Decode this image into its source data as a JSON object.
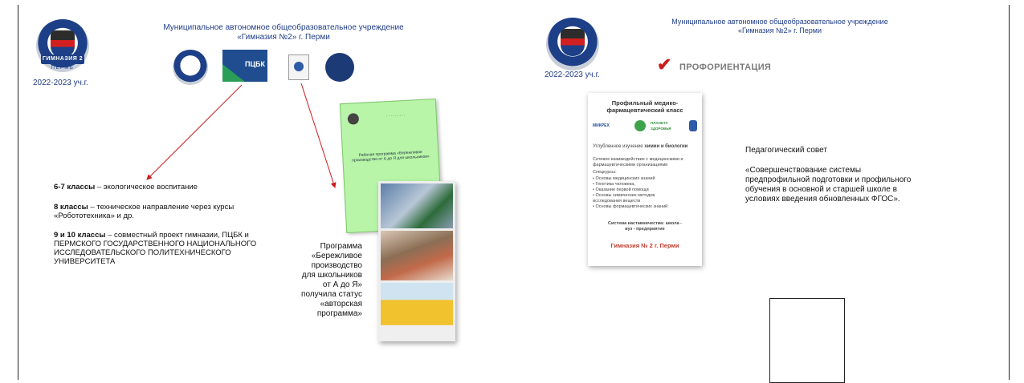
{
  "left_slide": {
    "header_line1": "Муниципальное автономное общеобразовательное учреждение",
    "header_line2": "«Гимназия №2» г. Перми",
    "year": "2022-2023 уч.г.",
    "logo_ribbon": "ГИМНАЗИЯ 2",
    "logo_perm": "ПЕРМЬ",
    "pcbk_label": "ПЦБК",
    "booklet_title": "Рабочая программа «Бережливое производство от А до Я для школьников»",
    "items": [
      {
        "bold": "6-7 классы",
        "text": " – экологическое воспитание"
      },
      {
        "bold": "8 классы",
        "text": " – техническое направление через курсы «Робототехника» и др."
      },
      {
        "bold": "9 и 10 классы",
        "text": " – совместный проект гимназии,  ПЦБК и ПЕРМСКОГО ГОСУДАРСТВЕННОГО НАЦИОНАЛЬНОГО ИССЛЕДОВАТЕЛЬСКОГО ПОЛИТЕХНИЧЕСКОГО  УНИВЕРСИТЕТА"
      }
    ],
    "program_text": "Программа «Бережливое производство для школьников от А до Я» получила статус «авторская программа»"
  },
  "right_slide": {
    "header_line1": "Муниципальное автономное общеобразовательное учреждение",
    "header_line2": "«Гимназия №2» г. Перми",
    "year": "2022-2023 уч.г.",
    "section_title": "ПРОФОРИЕНТАЦИЯ",
    "poster": {
      "title": "Профильный медико-фармацевтический класс",
      "logo1": "МИКРЕХ",
      "logo2": "ПЛАНЕТА ЗДОРОВЬЯ",
      "subtitle_pre": "Углубленное изучение ",
      "subtitle_bold": "химии и биологии",
      "network": "Сетевое взаимодействие с медицинскими и фармацевтическими организациями",
      "courses_label": "Спецкурсы:",
      "courses": [
        "Основы медицинских знаний",
        "Генетика человека,",
        "Оказание первой помощи",
        "Основы химических методов исследования веществ",
        "Основы формацевтических знаний"
      ],
      "mentoring": "Система наставничества: школа - вуз - предприятие",
      "school": "Гимназия № 2 г. Перми"
    },
    "council_label": "Педагогический совет",
    "council_text": "«Совершенствование системы предпрофильной подготовки и профильного обучения в основной и старшей школе в условиях введения обновленных ФГОС»."
  }
}
